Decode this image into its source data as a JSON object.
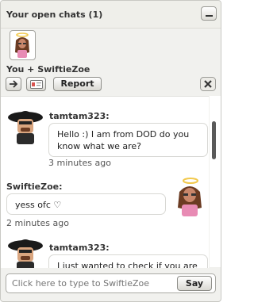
{
  "window": {
    "title": "Your open chats (1)"
  },
  "chat": {
    "header": "You + SwiftieZoe"
  },
  "toolbar": {
    "report_label": "Report"
  },
  "messages": [
    {
      "sender": "tamtam323:",
      "text": "Hello :) I am from DOD do you know what we are?",
      "time": "3 minutes ago"
    },
    {
      "sender": "SwiftieZoe:",
      "text": "yess ofc ♡",
      "time": "2 minutes ago"
    },
    {
      "sender": "tamtam323:",
      "text": "I just wanted to check if you are"
    }
  ],
  "composer": {
    "placeholder": "Click here to type to SwiftieZoe",
    "say_label": "Say"
  },
  "colors": {
    "window_bg": "#f1f1ee",
    "chat_bg": "#ffffff",
    "bubble_border": "#d8d8d4",
    "halo": "#f2c94c"
  },
  "icons": [
    "minimize-icon",
    "arrow-right-icon",
    "profile-card-icon",
    "close-icon"
  ]
}
